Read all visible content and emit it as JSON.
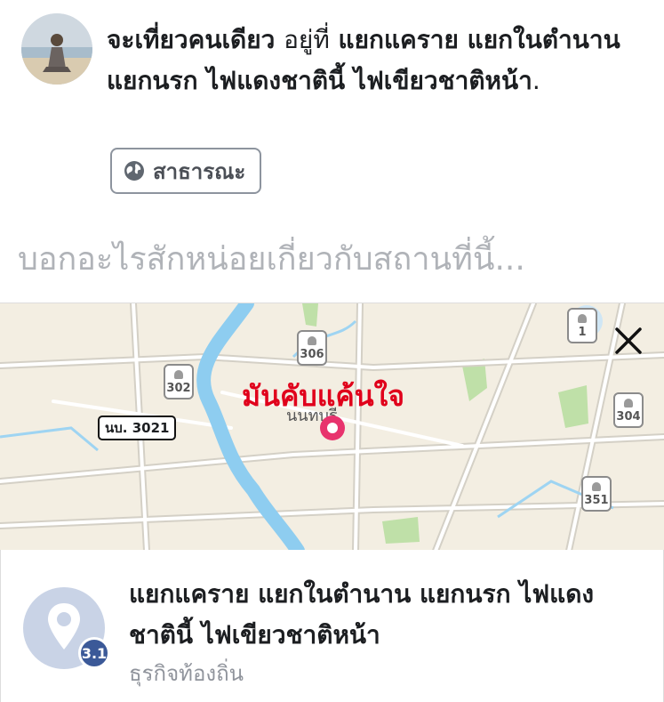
{
  "post": {
    "text_main": "จะเที่ยวคนเดียว",
    "text_at": "อยู่ที่",
    "text_location": "แยกแคราย แยกในตำนาน แยกนรก ไฟแดงชาตินี้ ไฟเขียวชาติหน้า",
    "text_end": "."
  },
  "privacy": {
    "label": "สาธารณะ",
    "icon": "globe-icon"
  },
  "composer": {
    "placeholder": "บอกอะไรสักหน่อยเกี่ยวกับสถานที่นี้..."
  },
  "map": {
    "pin_caption": "มันคับแค้นใจ",
    "town_label": "นนทบุรี",
    "road_label": "นบ. 3021",
    "shields": [
      "306",
      "302",
      "1",
      "304",
      "351"
    ],
    "close_icon": "close-icon"
  },
  "place": {
    "name": "แยกแคราย แยกในตำนาน แยกนรก ไฟแดงชาตินี้ ไฟเขียวชาติหน้า",
    "category": "ธุรกิจท้องถิ่น",
    "rating": "3.1",
    "icon": "map-pin-icon"
  },
  "colors": {
    "pin": "#e8336d",
    "river": "#8ecdf0",
    "accent_red": "#e0001b",
    "badge": "#3b5998"
  }
}
